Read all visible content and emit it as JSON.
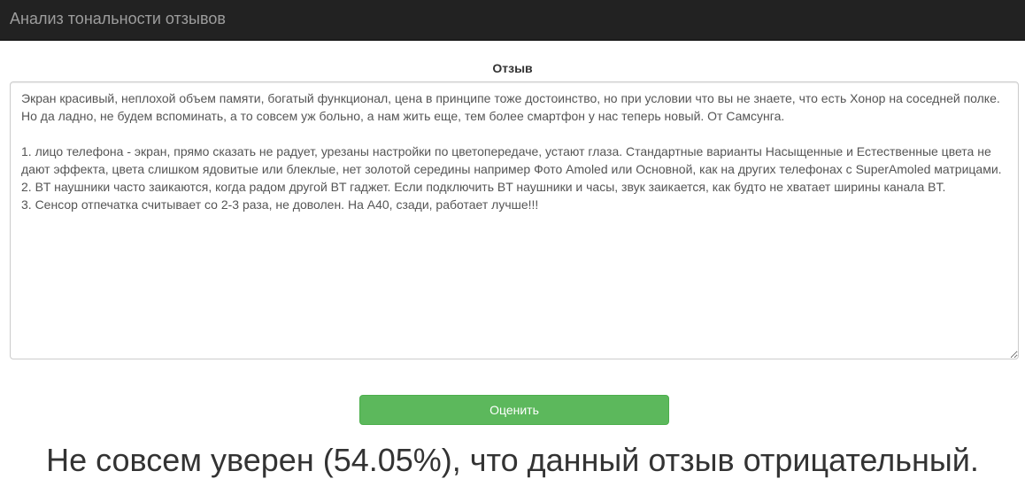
{
  "navbar": {
    "brand": "Анализ тональности отзывов"
  },
  "form": {
    "label": "Отзыв",
    "review_text": "Экран красивый, неплохой объем памяти, богатый функционал, цена в принципе тоже достоинство, но при условии что вы не знаете, что есть Хонор на соседней полке. Но да ладно, не будем вспоминать, а то совсем уж больно, а нам жить еще, тем более смартфон у нас теперь новый. От Самсунга.\n\n1. лицо телефона - экран, прямо сказать не радует, урезаны настройки по цветопередаче, устают глаза. Стандартные варианты Насыщенные и Естественные цвета не дают эффекта, цвета слишком ядовитые или блеклые, нет золотой середины например Фото Amoled или Основной, как на других телефонах с SuperAmoled матрицами.\n2. BT наушники часто заикаются, когда радом другой BT гаджет. Если подключить BT наушники и часы, звук заикается, как будто не хватает ширины канала BT.\n3. Сенсор отпечатка считывает со 2-3 раза, не доволен. На А40, сзади, работает лучше!!!",
    "submit_label": "Оценить"
  },
  "result": {
    "text": "Не совсем уверен (54.05%), что данный отзыв отрицательный."
  },
  "colors": {
    "navbar_bg": "#222222",
    "brand_text": "#9d9d9d",
    "button_bg": "#5cb85c",
    "button_border": "#4cae4c"
  }
}
